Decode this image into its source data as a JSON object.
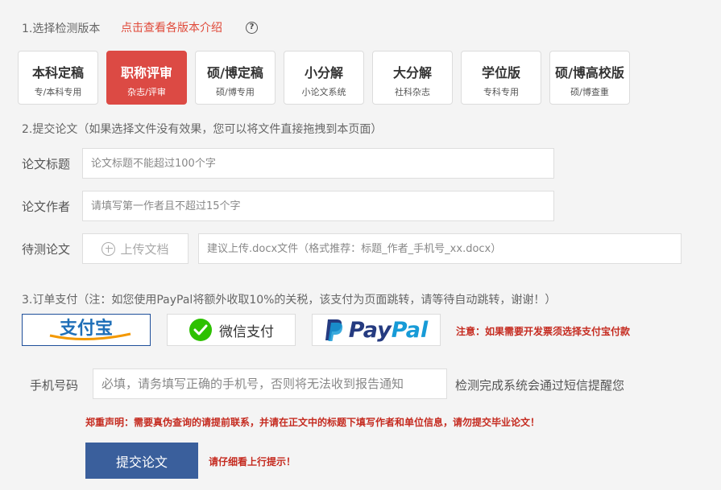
{
  "step1": {
    "title": "1.选择检测版本",
    "intro_link": "点击查看各版本介绍",
    "help_icon": "?"
  },
  "versions": [
    {
      "name": "本科定稿",
      "sub": "专/本科专用"
    },
    {
      "name": "职称评审",
      "sub": "杂志/评审",
      "active": true
    },
    {
      "name": "硕/博定稿",
      "sub": "硕/博专用"
    },
    {
      "name": "小分解",
      "sub": "小论文系统"
    },
    {
      "name": "大分解",
      "sub": "社科杂志"
    },
    {
      "name": "学位版",
      "sub": "专科专用"
    },
    {
      "name": "硕/博高校版",
      "sub": "硕/博查重"
    }
  ],
  "step2": {
    "title": "2.提交论文（如果选择文件没有效果，您可以将文件直接拖拽到本页面）",
    "title_label": "论文标题",
    "title_placeholder": "论文标题不能超过100个字",
    "author_label": "论文作者",
    "author_placeholder": "请填写第一作者且不超过15个字",
    "paper_label": "待测论文",
    "upload_label": "上传文档",
    "file_placeholder": "建议上传.docx文件（格式推荐：标题_作者_手机号_xx.docx）"
  },
  "step3": {
    "title": "3.订单支付（注：如您使用PayPal将额外收取10%的关税，该支付为页面跳转，请等待自动跳转，谢谢！）",
    "alipay_label": "支付宝",
    "wechat_label": "微信支付",
    "paypal_label_1": "Pay",
    "paypal_label_2": "Pal",
    "invoice_note": "注意：如果需要开发票须选择支付宝付款"
  },
  "phone": {
    "label": "手机号码",
    "placeholder": "必填，请务填写正确的手机号，否则将无法收到报告通知",
    "hint": "检测完成系统会通过短信提醒您"
  },
  "statement": "郑重声明：需要真伪查询的请提前联系，并请在正文中的标题下填写作者和单位信息，请勿提交毕业论文！",
  "submit": {
    "label": "提交论文",
    "note": "请仔细看上行提示！"
  },
  "colors": {
    "accent_red": "#dc4a44",
    "submit_blue": "#3a5f9c",
    "alipay_blue": "#1f6fb8",
    "alipay_orange": "#f39800",
    "wechat_green": "#2dc100",
    "paypal_dark": "#253b80",
    "paypal_light": "#179bd7"
  }
}
